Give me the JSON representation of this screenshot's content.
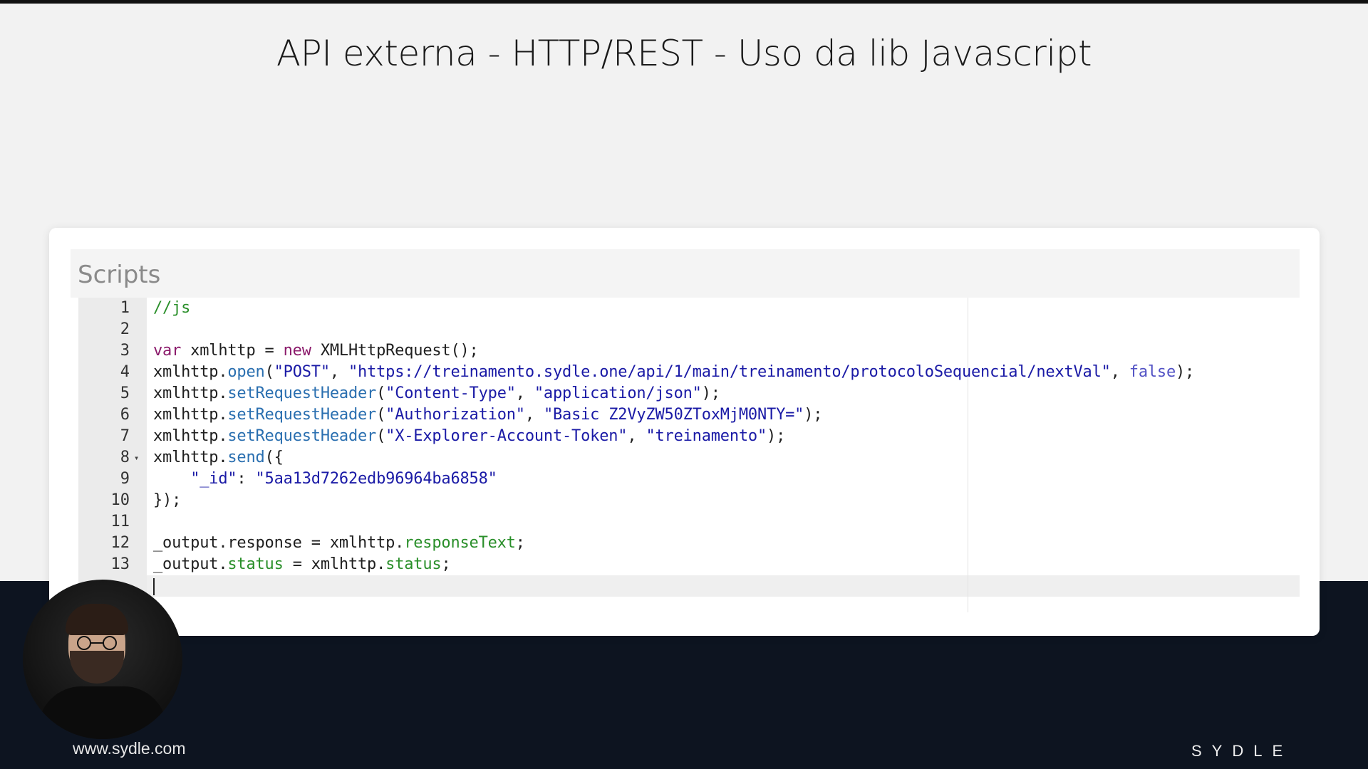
{
  "slide": {
    "title": "API externa - HTTP/REST - Uso da lib Javascript"
  },
  "panel": {
    "section_title": "Scripts"
  },
  "editor": {
    "line_numbers": [
      "1",
      "2",
      "3",
      "4",
      "5",
      "6",
      "7",
      "8",
      "9",
      "10",
      "11",
      "12",
      "13"
    ],
    "folded_line": 8,
    "lines": [
      [
        {
          "t": "//js",
          "c": "comment"
        }
      ],
      [],
      [
        {
          "t": "var",
          "c": "keyword"
        },
        {
          "t": " xmlhttp = ",
          "c": "plain"
        },
        {
          "t": "new",
          "c": "keyword"
        },
        {
          "t": " XMLHttpRequest();",
          "c": "plain"
        }
      ],
      [
        {
          "t": "xmlhttp.",
          "c": "plain"
        },
        {
          "t": "open",
          "c": "prop"
        },
        {
          "t": "(",
          "c": "plain"
        },
        {
          "t": "\"POST\"",
          "c": "string"
        },
        {
          "t": ", ",
          "c": "plain"
        },
        {
          "t": "\"https://treinamento.sydle.one/api/1/main/treinamento/protocoloSequencial/nextVal\"",
          "c": "string"
        },
        {
          "t": ", ",
          "c": "plain"
        },
        {
          "t": "false",
          "c": "bool"
        },
        {
          "t": ");",
          "c": "plain"
        }
      ],
      [
        {
          "t": "xmlhttp.",
          "c": "plain"
        },
        {
          "t": "setRequestHeader",
          "c": "prop"
        },
        {
          "t": "(",
          "c": "plain"
        },
        {
          "t": "\"Content-Type\"",
          "c": "string"
        },
        {
          "t": ", ",
          "c": "plain"
        },
        {
          "t": "\"application/json\"",
          "c": "string"
        },
        {
          "t": ");",
          "c": "plain"
        }
      ],
      [
        {
          "t": "xmlhttp.",
          "c": "plain"
        },
        {
          "t": "setRequestHeader",
          "c": "prop"
        },
        {
          "t": "(",
          "c": "plain"
        },
        {
          "t": "\"Authorization\"",
          "c": "string"
        },
        {
          "t": ", ",
          "c": "plain"
        },
        {
          "t": "\"Basic Z2VyZW50ZToxMjM0NTY=\"",
          "c": "string"
        },
        {
          "t": ");",
          "c": "plain"
        }
      ],
      [
        {
          "t": "xmlhttp.",
          "c": "plain"
        },
        {
          "t": "setRequestHeader",
          "c": "prop"
        },
        {
          "t": "(",
          "c": "plain"
        },
        {
          "t": "\"X-Explorer-Account-Token\"",
          "c": "string"
        },
        {
          "t": ", ",
          "c": "plain"
        },
        {
          "t": "\"treinamento\"",
          "c": "string"
        },
        {
          "t": ");",
          "c": "plain"
        }
      ],
      [
        {
          "t": "xmlhttp.",
          "c": "plain"
        },
        {
          "t": "send",
          "c": "prop"
        },
        {
          "t": "({",
          "c": "plain"
        }
      ],
      [
        {
          "t": "    ",
          "c": "plain"
        },
        {
          "t": "\"_id\"",
          "c": "string"
        },
        {
          "t": ": ",
          "c": "plain"
        },
        {
          "t": "\"5aa13d7262edb96964ba6858\"",
          "c": "string"
        }
      ],
      [
        {
          "t": "});",
          "c": "plain"
        }
      ],
      [],
      [
        {
          "t": "_output.response = xmlhttp.",
          "c": "plain"
        },
        {
          "t": "responseText",
          "c": "green"
        },
        {
          "t": ";",
          "c": "plain"
        }
      ],
      [
        {
          "t": "_output.",
          "c": "plain"
        },
        {
          "t": "status",
          "c": "green"
        },
        {
          "t": " = xmlhttp.",
          "c": "plain"
        },
        {
          "t": "status",
          "c": "green"
        },
        {
          "t": ";",
          "c": "plain"
        }
      ]
    ]
  },
  "footer": {
    "website": "www.sydle.com",
    "brand": "SYDLE"
  },
  "icons": {
    "fold": "fold-toggle-icon"
  }
}
